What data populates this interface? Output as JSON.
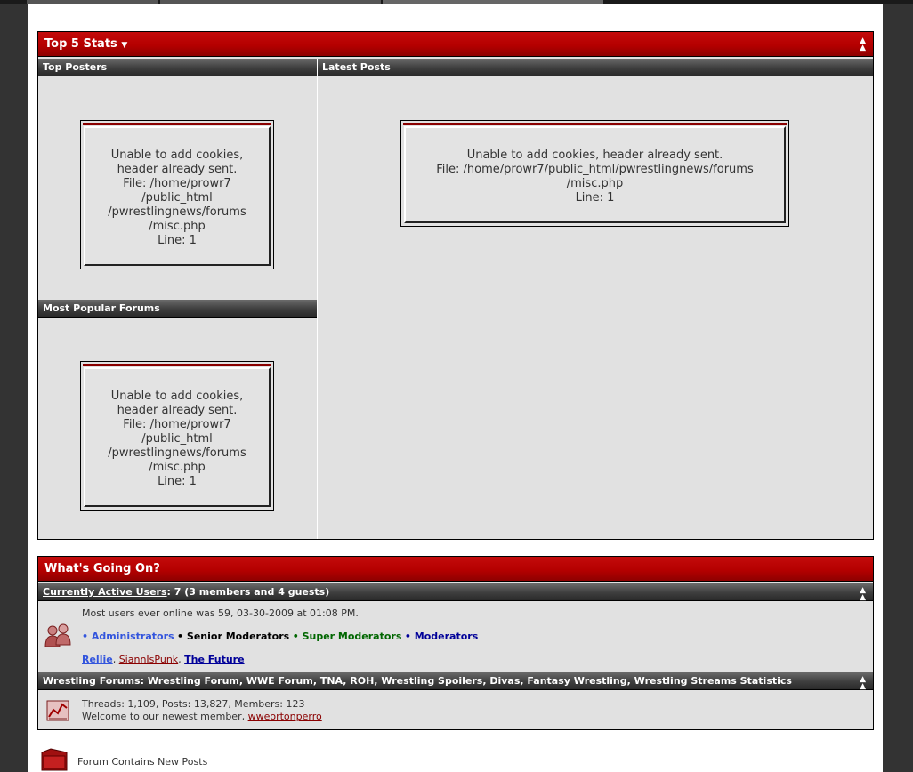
{
  "stats": {
    "title": "Top 5 Stats",
    "collapse_icon": "collapse-icon",
    "top_posters": {
      "header": "Top Posters",
      "error": [
        "Unable to add cookies,",
        "header already sent.",
        "File: /home/prowr7",
        "/public_html",
        "/pwrestlingnews/forums",
        "/misc.php",
        "Line: 1"
      ]
    },
    "latest_posts": {
      "header": "Latest Posts",
      "error": [
        "Unable to add cookies, header already sent.",
        "File: /home/prowr7/public_html/pwrestlingnews/forums",
        "/misc.php",
        "Line: 1"
      ]
    },
    "popular_forums": {
      "header": "Most Popular Forums",
      "error": [
        "Unable to add cookies,",
        "header already sent.",
        "File: /home/prowr7",
        "/public_html",
        "/pwrestlingnews/forums",
        "/misc.php",
        "Line: 1"
      ]
    }
  },
  "wgo": {
    "title": "What's Going On?",
    "active_users_link": "Currently Active Users",
    "active_users_count": ": 7 (3 members and 4 guests)",
    "most_users": "Most users ever online was 59, 03-30-2009 at 01:08 PM.",
    "legend": [
      {
        "label": "Administrators",
        "color": "#3355dd"
      },
      {
        "label": "Senior Moderators",
        "color": "#000000"
      },
      {
        "label": "Super Moderators",
        "color": "#006600"
      },
      {
        "label": "Moderators",
        "color": "#000099"
      }
    ],
    "members": [
      {
        "name": "Rellie",
        "color": "#3355dd",
        "bold": true
      },
      {
        "name": "SiannIsPunk",
        "color": "#8a0000",
        "bold": false
      },
      {
        "name": "The Future",
        "color": "#000099",
        "bold": true
      }
    ],
    "stats_header": "Wrestling Forums: Wrestling Forum, WWE Forum, TNA, ROH, Wrestling Spoilers, Divas, Fantasy Wrestling, Wrestling Streams Statistics",
    "stats_line": "Threads: 1,109, Posts: 13,827, Members: 123",
    "welcome_text": "Welcome to our newest member, ",
    "newest_member": "wweortonperro",
    "colors": {
      "accent_red": "#b50000",
      "dark_grey": "#3e3e3e",
      "panel": "#e1e1e1"
    }
  },
  "footer_legend": {
    "new_posts_label": "Forum Contains New Posts"
  }
}
